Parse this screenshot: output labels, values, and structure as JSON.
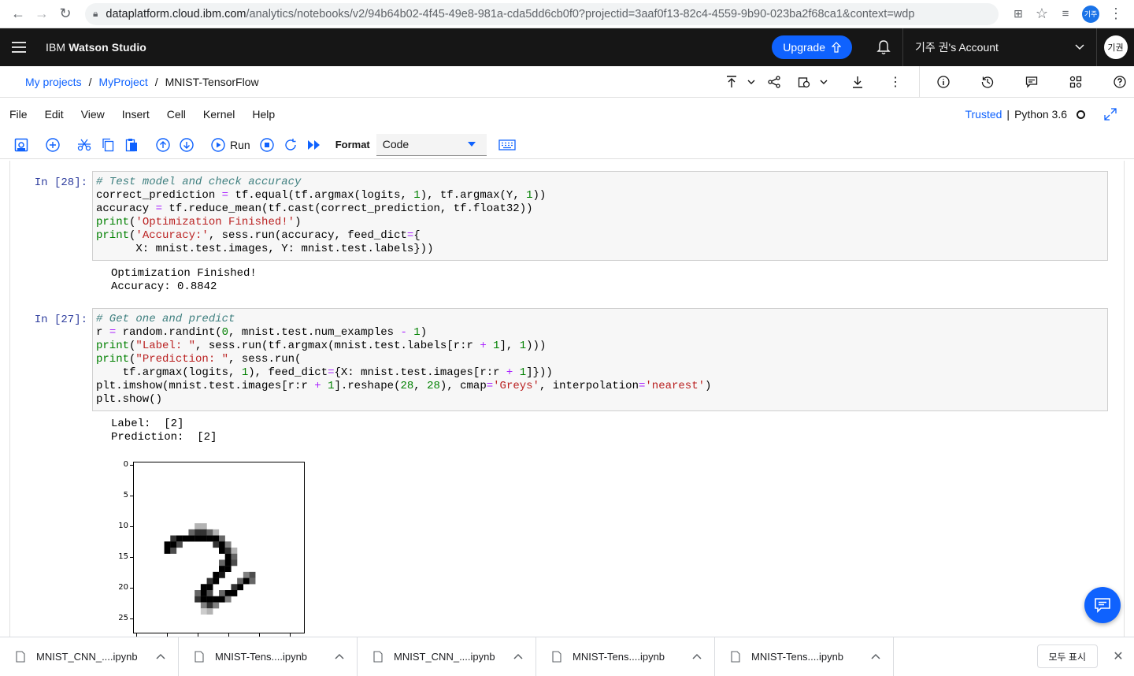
{
  "browser": {
    "url_host": "dataplatform.cloud.ibm.com",
    "url_path": "/analytics/notebooks/v2/94b64b02-4f45-49e8-981a-cda5dd6cb0f0?projectid=3aaf0f13-82c4-4559-9b90-023ba2f68ca1&context=wdp",
    "profile_initials": "기주"
  },
  "header": {
    "brand_prefix": "IBM ",
    "brand_name": "Watson Studio",
    "upgrade_label": "Upgrade",
    "account_label": "기주 권's Account",
    "avatar_initials": "기권"
  },
  "breadcrumb": {
    "items": [
      "My projects",
      "MyProject",
      "MNIST-TensorFlow"
    ],
    "separator": "/"
  },
  "menubar": {
    "items": [
      "File",
      "Edit",
      "View",
      "Insert",
      "Cell",
      "Kernel",
      "Help"
    ],
    "trusted_label": "Trusted",
    "kernel_label": "Python 3.6"
  },
  "toolbar": {
    "run_label": "Run",
    "format_label": "Format",
    "format_value": "Code"
  },
  "cells": [
    {
      "prompt": "In [28]:",
      "code_lines": [
        "# Test model and check accuracy",
        "correct_prediction = tf.equal(tf.argmax(logits, 1), tf.argmax(Y, 1))",
        "accuracy = tf.reduce_mean(tf.cast(correct_prediction, tf.float32))",
        "print('Optimization Finished!')",
        "print('Accuracy:', sess.run(accuracy, feed_dict={",
        "      X: mnist.test.images, Y: mnist.test.labels}))"
      ],
      "output": "Optimization Finished!\nAccuracy: 0.8842"
    },
    {
      "prompt": "In [27]:",
      "code_lines": [
        "# Get one and predict",
        "r = random.randint(0, mnist.test.num_examples - 1)",
        "print(\"Label: \", sess.run(tf.argmax(mnist.test.labels[r:r + 1], 1)))",
        "print(\"Prediction: \", sess.run(",
        "    tf.argmax(logits, 1), feed_dict={X: mnist.test.images[r:r + 1]}))",
        "plt.imshow(mnist.test.images[r:r + 1].reshape(28, 28), cmap='Greys', interpolation='nearest')",
        "plt.show()"
      ],
      "output": "Label:  [2]\nPrediction:  [2]"
    }
  ],
  "plot": {
    "y_ticks": [
      "0",
      "5",
      "10",
      "15",
      "20",
      "25"
    ]
  },
  "chart_data": {
    "type": "heatmap",
    "colormap": "Greys",
    "rows": 28,
    "cols": 28,
    "y_tick_labels": [
      0,
      5,
      10,
      15,
      20,
      25
    ],
    "pixels": [
      [
        10,
        10,
        0.3
      ],
      [
        11,
        10,
        0.3
      ],
      [
        9,
        11,
        0.6
      ],
      [
        10,
        11,
        0.8
      ],
      [
        11,
        11,
        0.8
      ],
      [
        12,
        11,
        0.6
      ],
      [
        13,
        11,
        0.3
      ],
      [
        6,
        12,
        0.8
      ],
      [
        7,
        12,
        1.0
      ],
      [
        8,
        12,
        1.0
      ],
      [
        9,
        12,
        1.0
      ],
      [
        10,
        12,
        1.0
      ],
      [
        11,
        12,
        1.0
      ],
      [
        12,
        12,
        1.0
      ],
      [
        13,
        12,
        1.0
      ],
      [
        14,
        12,
        0.6
      ],
      [
        5,
        13,
        1.0
      ],
      [
        6,
        13,
        1.0
      ],
      [
        7,
        13,
        0.7
      ],
      [
        13,
        13,
        0.8
      ],
      [
        14,
        13,
        1.0
      ],
      [
        15,
        13,
        0.5
      ],
      [
        5,
        14,
        1.0
      ],
      [
        6,
        14,
        0.7
      ],
      [
        14,
        14,
        1.0
      ],
      [
        15,
        14,
        0.8
      ],
      [
        16,
        14,
        0.3
      ],
      [
        15,
        15,
        1.0
      ],
      [
        16,
        15,
        0.6
      ],
      [
        14,
        16,
        0.6
      ],
      [
        15,
        16,
        1.0
      ],
      [
        16,
        16,
        0.7
      ],
      [
        14,
        17,
        1.0
      ],
      [
        15,
        17,
        1.0
      ],
      [
        13,
        18,
        1.0
      ],
      [
        14,
        18,
        0.9
      ],
      [
        18,
        18,
        0.5
      ],
      [
        19,
        18,
        0.7
      ],
      [
        12,
        19,
        0.8
      ],
      [
        13,
        19,
        1.0
      ],
      [
        17,
        19,
        0.6
      ],
      [
        18,
        19,
        1.0
      ],
      [
        19,
        19,
        0.6
      ],
      [
        11,
        20,
        1.0
      ],
      [
        12,
        20,
        1.0
      ],
      [
        16,
        20,
        0.8
      ],
      [
        17,
        20,
        1.0
      ],
      [
        10,
        21,
        0.6
      ],
      [
        11,
        21,
        1.0
      ],
      [
        12,
        21,
        0.7
      ],
      [
        14,
        21,
        0.6
      ],
      [
        15,
        21,
        1.0
      ],
      [
        16,
        21,
        1.0
      ],
      [
        10,
        22,
        0.8
      ],
      [
        11,
        22,
        1.0
      ],
      [
        12,
        22,
        1.0
      ],
      [
        13,
        22,
        1.0
      ],
      [
        14,
        22,
        1.0
      ],
      [
        15,
        22,
        0.5
      ],
      [
        11,
        23,
        0.5
      ],
      [
        12,
        23,
        0.8
      ],
      [
        13,
        23,
        0.5
      ],
      [
        11,
        24,
        0.2
      ],
      [
        12,
        24,
        0.3
      ]
    ]
  },
  "downloads": {
    "items": [
      "MNIST_CNN_....ipynb",
      "MNIST-Tens....ipynb",
      "MNIST_CNN_....ipynb",
      "MNIST-Tens....ipynb",
      "MNIST-Tens....ipynb"
    ],
    "show_all_label": "모두 표시"
  }
}
